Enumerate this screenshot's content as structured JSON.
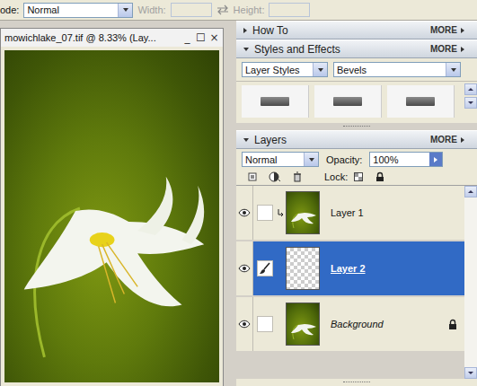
{
  "options_bar": {
    "mode_label": "ode:",
    "mode": "Normal",
    "width_label": "Width:",
    "height_label": "Height:",
    "size_disabled": true
  },
  "document": {
    "title": "mowichlake_07.tif @ 8.33% (Lay...",
    "controls": [
      "_",
      "☐",
      "×"
    ]
  },
  "how_to": {
    "title": "How To",
    "more": "MORE",
    "expanded": false
  },
  "styles": {
    "title": "Styles and Effects",
    "more": "MORE",
    "expanded": true,
    "category": "Layer Styles",
    "type": "Bevels"
  },
  "layers": {
    "title": "Layers",
    "more": "MORE",
    "expanded": true,
    "blend_mode": "Normal",
    "opacity_label": "Opacity:",
    "opacity": "100%",
    "lock_label": "Lock:",
    "items": [
      {
        "name": "Layer 1",
        "visible": true,
        "selected": false,
        "brush": false,
        "clipped": true,
        "locked": false,
        "italic": false,
        "kind": "photo"
      },
      {
        "name": "Layer 2",
        "visible": true,
        "selected": true,
        "brush": true,
        "clipped": false,
        "locked": false,
        "italic": false,
        "kind": "transparent"
      },
      {
        "name": "Background",
        "visible": true,
        "selected": false,
        "brush": false,
        "clipped": false,
        "locked": true,
        "italic": true,
        "kind": "photo"
      }
    ]
  }
}
